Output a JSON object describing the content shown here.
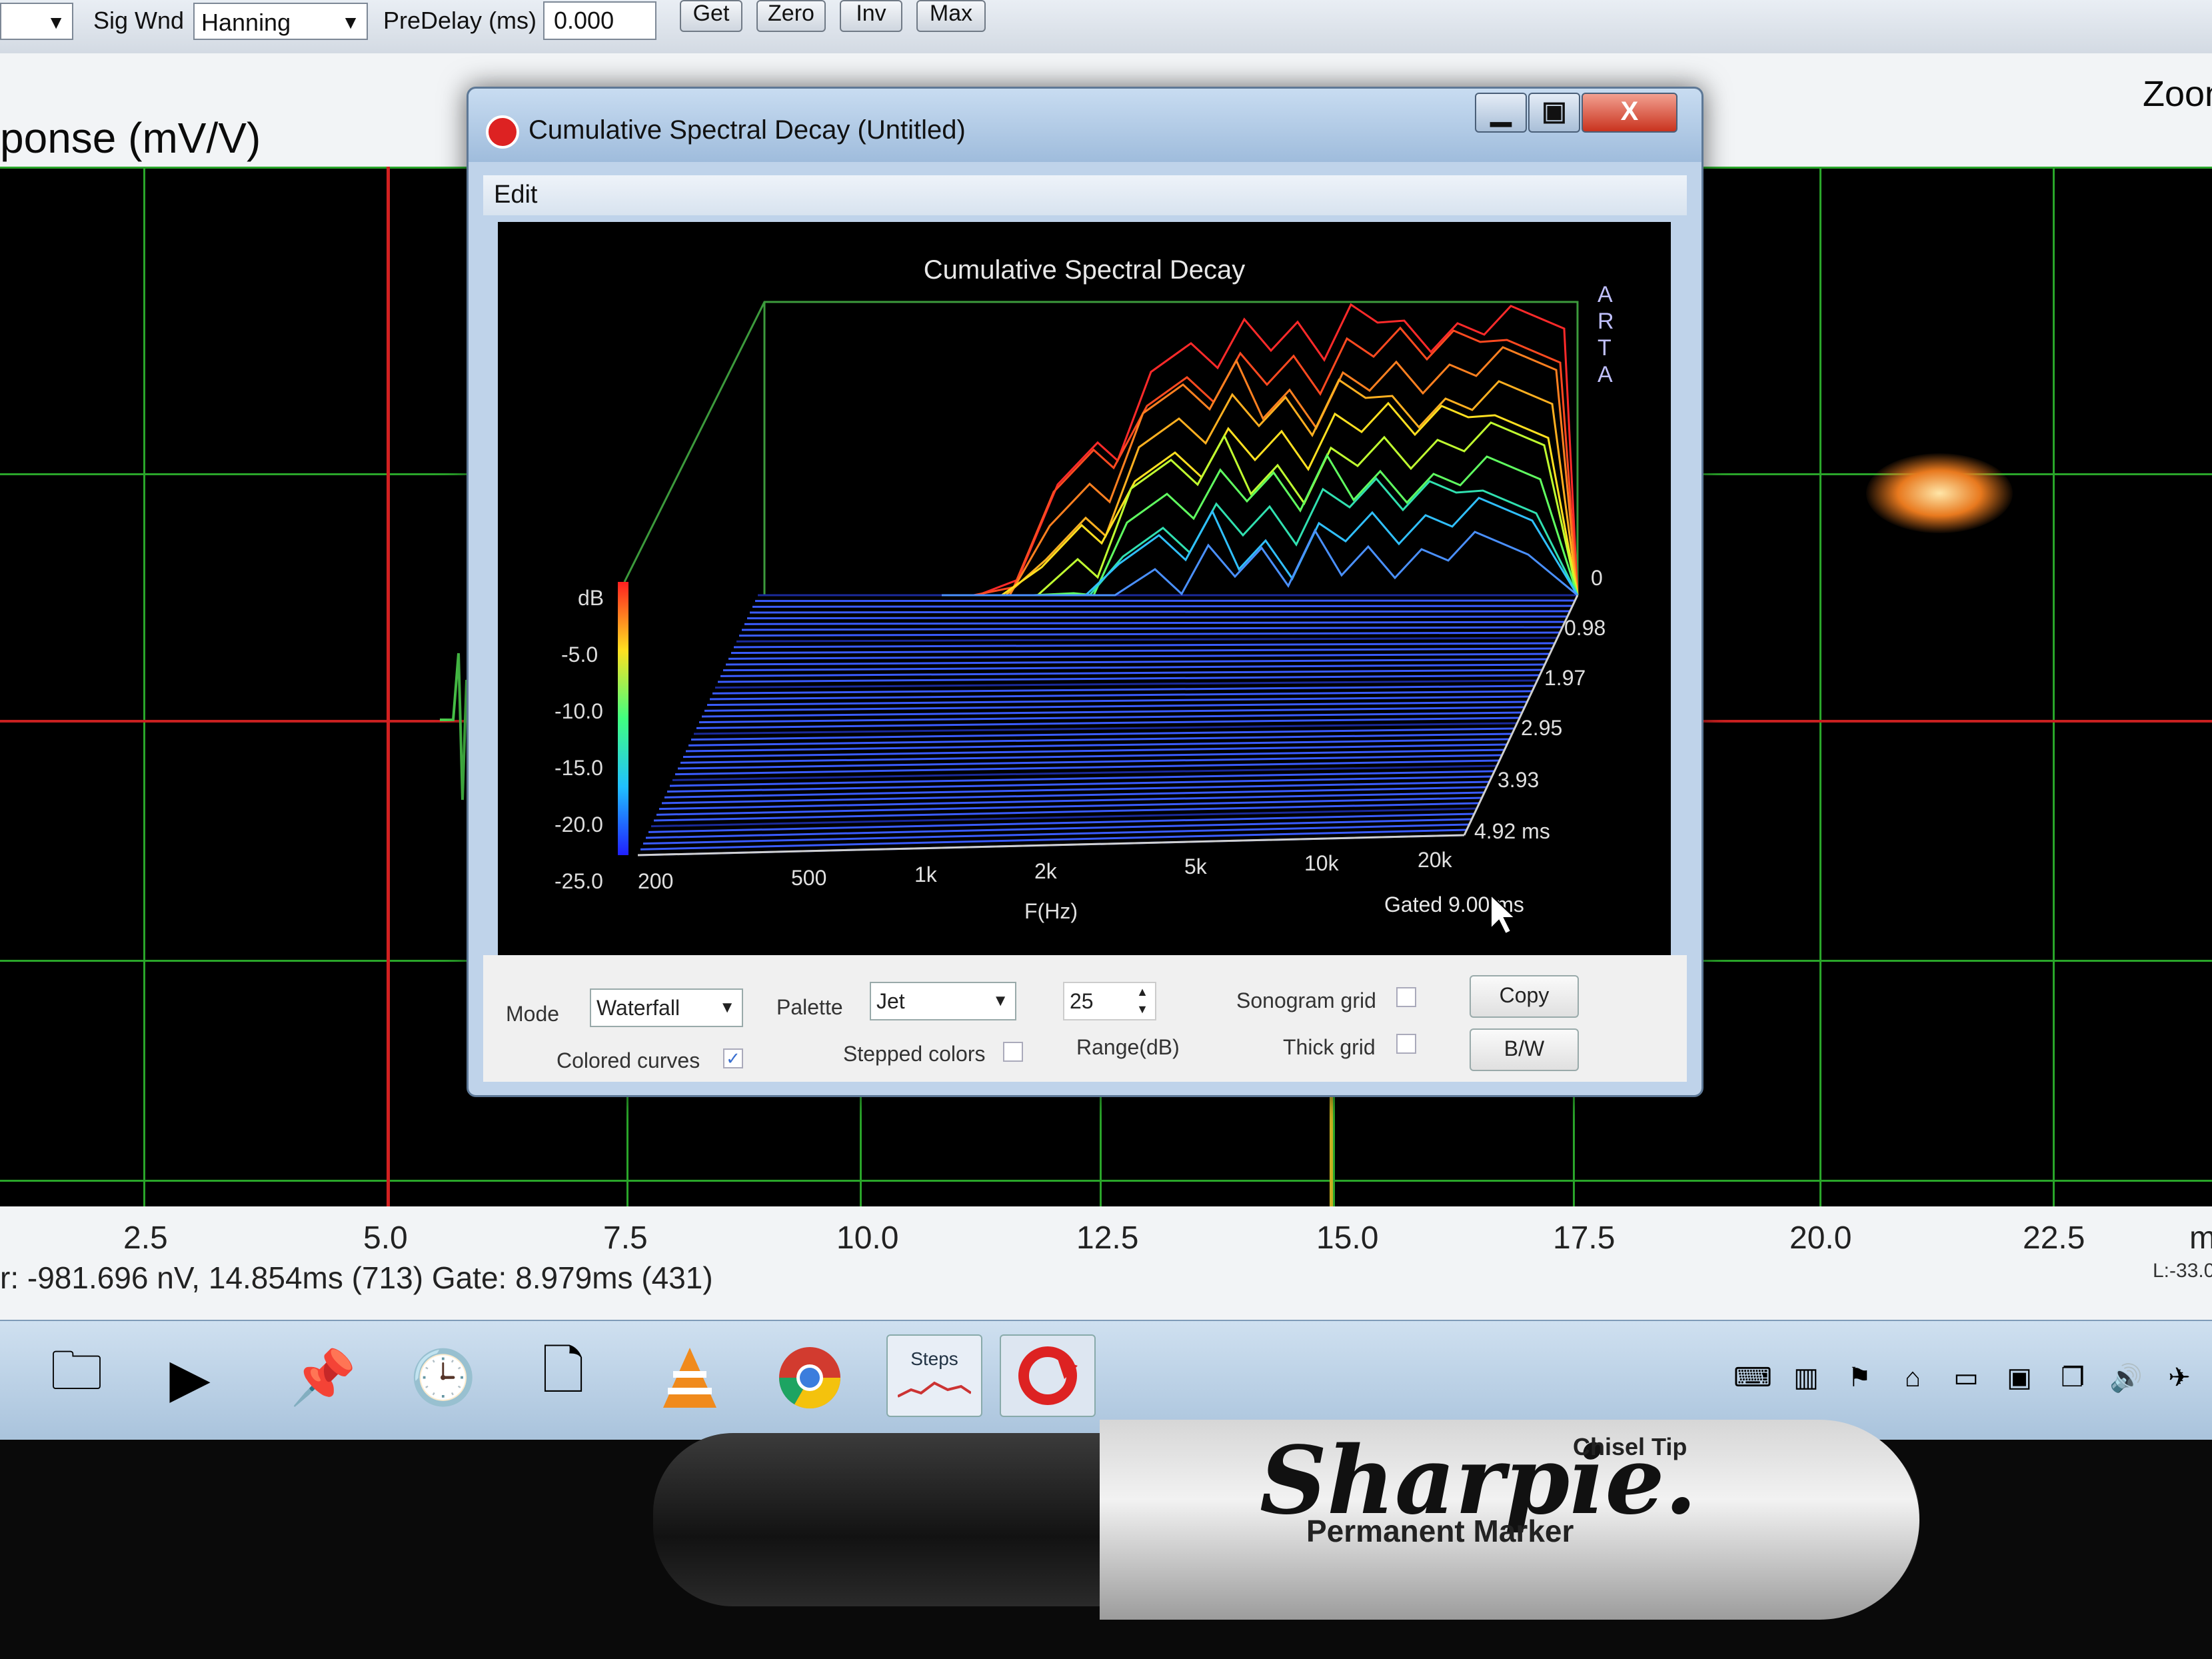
{
  "toolbar": {
    "sig_wnd_label": "Sig Wnd",
    "sig_wnd_value": "Hanning",
    "predelay_label": "PreDelay (ms)",
    "predelay_value": "0.000",
    "get_label": "Get",
    "zero_label": "Zero",
    "inv_label": "Inv",
    "max_label": "Max"
  },
  "main": {
    "plot_title": "ponse (mV/V)",
    "zoom_label": "Zoon",
    "x_ticks": [
      "2.5",
      "5.0",
      "7.5",
      "10.0",
      "12.5",
      "15.0",
      "17.5",
      "20.0",
      "22.5"
    ],
    "x_unit": "m",
    "status_text": "r: -981.696 nV, 14.854ms (713)  Gate: 8.979ms (431)",
    "level_text": "L:-33.0"
  },
  "csd_window": {
    "title": "Cumulative Spectral Decay  (Untitled)",
    "menu_edit": "Edit",
    "minimize_symbol": "▁",
    "maximize_symbol": "▣",
    "close_symbol": "X",
    "plot_title": "Cumulative Spectral Decay",
    "watermark": [
      "A",
      "R",
      "T",
      "A"
    ],
    "db_label": "dB",
    "db_ticks": [
      "-5.0",
      "-10.0",
      "-15.0",
      "-20.0",
      "-25.0"
    ],
    "freq_ticks": [
      "200",
      "500",
      "1k",
      "2k",
      "5k",
      "10k",
      "20k"
    ],
    "freq_label": "F(Hz)",
    "time_ticks": [
      "0",
      "0.98",
      "1.97",
      "2.95",
      "3.93",
      "4.92 ms"
    ],
    "gated_label": "Gated 9.00 ms",
    "mode_label": "Mode",
    "mode_value": "Waterfall",
    "palette_label": "Palette",
    "palette_value": "Jet",
    "range_value": "25",
    "range_label": "Range(dB)",
    "sonogram_grid_label": "Sonogram grid",
    "thick_grid_label": "Thick grid",
    "copy_label": "Copy",
    "bw_label": "B/W",
    "colored_curves_label": "Colored curves",
    "colored_curves_checked": true,
    "stepped_colors_label": "Stepped colors",
    "check_symbol": "✓"
  },
  "taskbar": {
    "steps_label": "Steps"
  },
  "marker": {
    "brand": "Sharpie.",
    "subtitle": "Permanent  Marker",
    "tip": "Chisel Tip"
  }
}
